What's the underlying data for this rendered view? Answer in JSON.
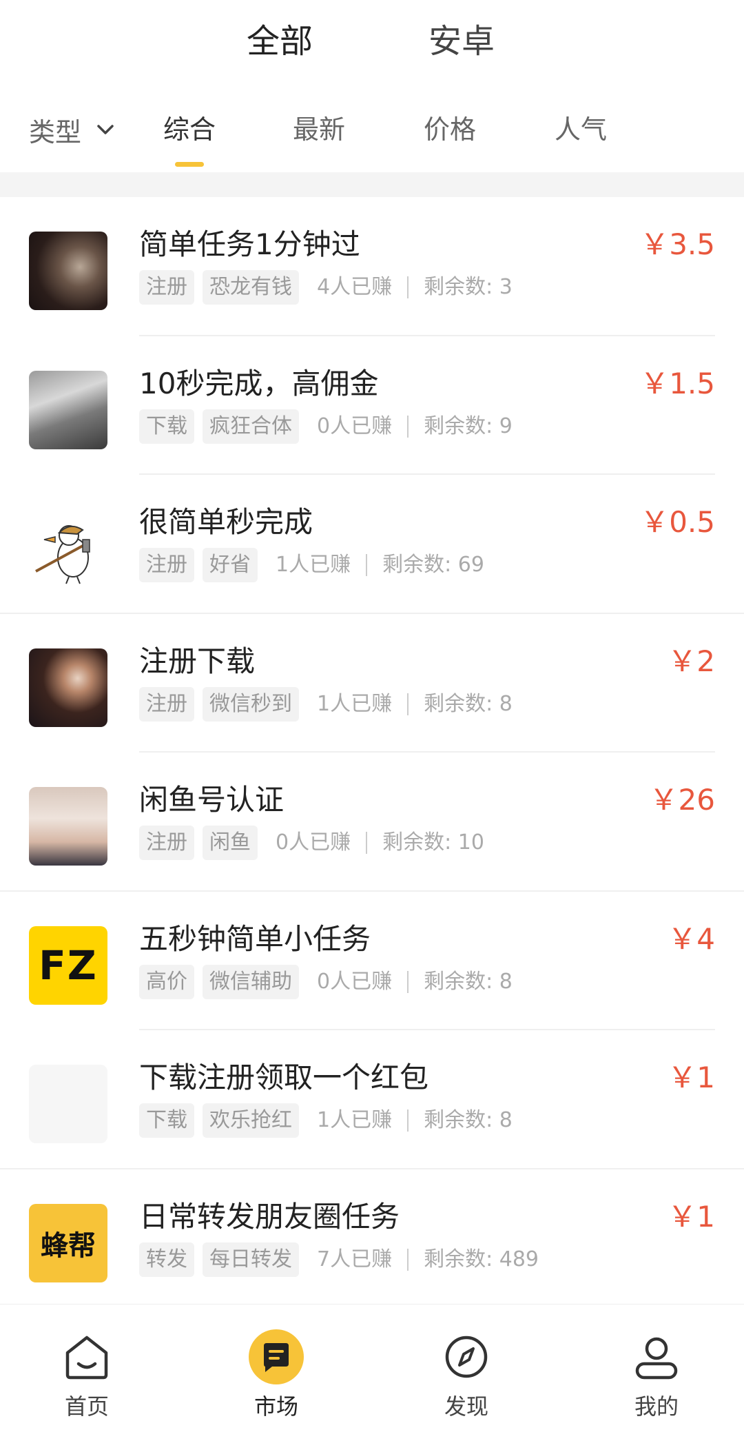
{
  "platform_tabs": {
    "all": "全部",
    "android": "安卓"
  },
  "sort_bar": {
    "type_filter": "类型",
    "tabs": [
      "综合",
      "最新",
      "价格",
      "人气"
    ],
    "active_index": 0
  },
  "tasks": [
    {
      "title": "简单任务1分钟过",
      "price": "￥3.5",
      "tags": [
        "注册",
        "恐龙有钱"
      ],
      "earned": "4人已赚",
      "remaining": "剩余数: 3",
      "thumb": "dark-photo"
    },
    {
      "title": "10秒完成，高佣金",
      "price": "￥1.5",
      "tags": [
        "下载",
        "疯狂合体"
      ],
      "earned": "0人已赚",
      "remaining": "剩余数: 9",
      "thumb": "elephant-photo"
    },
    {
      "title": "很简单秒完成",
      "price": "￥0.5",
      "tags": [
        "注册",
        "好省"
      ],
      "earned": "1人已赚",
      "remaining": "剩余数: 69",
      "thumb": "duck-cartoon"
    },
    {
      "title": "注册下载",
      "price": "￥2",
      "tags": [
        "注册",
        "微信秒到"
      ],
      "earned": "1人已赚",
      "remaining": "剩余数: 8",
      "thumb": "man-photo"
    },
    {
      "title": "闲鱼号认证",
      "price": "￥26",
      "tags": [
        "注册",
        "闲鱼"
      ],
      "earned": "0人已赚",
      "remaining": "剩余数: 10",
      "thumb": "girl-photo"
    },
    {
      "title": "五秒钟简单小任务",
      "price": "￥4",
      "tags": [
        "高价",
        "微信辅助"
      ],
      "earned": "0人已赚",
      "remaining": "剩余数: 8",
      "thumb": "fz-logo",
      "logo_text": "FZ"
    },
    {
      "title": "下载注册领取一个红包",
      "price": "￥1",
      "tags": [
        "下载",
        "欢乐抢红"
      ],
      "earned": "1人已赚",
      "remaining": "剩余数: 8",
      "thumb": "blank"
    },
    {
      "title": "日常转发朋友圈任务",
      "price": "￥1",
      "tags": [
        "转发",
        "每日转发"
      ],
      "earned": "7人已赚",
      "remaining": "剩余数: 489",
      "thumb": "fengbang-logo",
      "logo_text": "蜂帮"
    }
  ],
  "bottom_nav": [
    {
      "label": "首页",
      "icon": "home-icon"
    },
    {
      "label": "市场",
      "icon": "market-icon",
      "active": true
    },
    {
      "label": "发现",
      "icon": "compass-icon"
    },
    {
      "label": "我的",
      "icon": "profile-icon"
    }
  ],
  "colors": {
    "accent": "#f7c338",
    "price": "#e8573d",
    "tag_bg": "#f2f2f2"
  }
}
